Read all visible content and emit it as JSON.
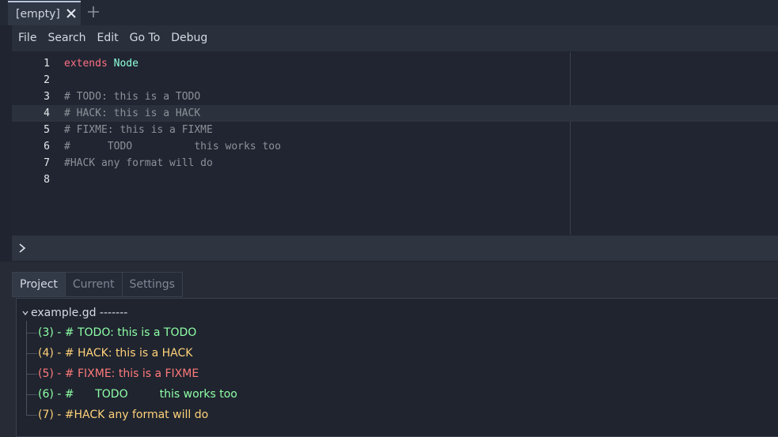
{
  "tab": {
    "title": "[empty]"
  },
  "menu": [
    "File",
    "Search",
    "Edit",
    "Go To",
    "Debug"
  ],
  "editor": {
    "current_line": 4,
    "lines": [
      {
        "num": "1",
        "kw": "extends",
        "ident": "Node",
        "comment": ""
      },
      {
        "num": "2",
        "kw": "",
        "ident": "",
        "comment": ""
      },
      {
        "num": "3",
        "kw": "",
        "ident": "",
        "comment": "# TODO: this is a TODO"
      },
      {
        "num": "4",
        "kw": "",
        "ident": "",
        "comment": "# HACK: this is a HACK"
      },
      {
        "num": "5",
        "kw": "",
        "ident": "",
        "comment": "# FIXME: this is a FIXME"
      },
      {
        "num": "6",
        "kw": "",
        "ident": "",
        "comment": "#      TODO          this works too"
      },
      {
        "num": "7",
        "kw": "",
        "ident": "",
        "comment": "#HACK any format will do"
      },
      {
        "num": "8",
        "kw": "",
        "ident": "",
        "comment": ""
      }
    ]
  },
  "panel": {
    "tabs": [
      "Project",
      "Current",
      "Settings"
    ],
    "active_tab": 0
  },
  "tree": {
    "root": "example.gd -------",
    "items": [
      {
        "text": "(3) - # TODO: this is a TODO",
        "color": "#8fffa6"
      },
      {
        "text": "(4) - # HACK: this is a HACK",
        "color": "#ffd27a"
      },
      {
        "text": "(5) - # FIXME: this is a FIXME",
        "color": "#ff7a7a"
      },
      {
        "text": "(6) - #      TODO         this works too",
        "color": "#8fffa6"
      },
      {
        "text": "(7) - #HACK any format will do",
        "color": "#ffd27a"
      }
    ]
  },
  "icons": {
    "tab_close": "close-icon",
    "tab_add": "plus-icon",
    "console_toggle": "chevron-right-icon",
    "tree_expand": "chevron-down-icon"
  }
}
